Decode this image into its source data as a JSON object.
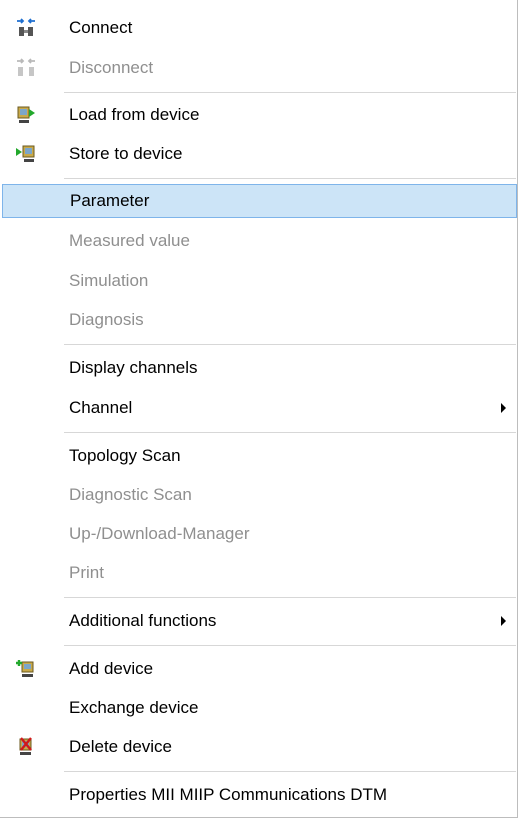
{
  "menu": {
    "connect": "Connect",
    "disconnect": "Disconnect",
    "load_from_device": "Load from device",
    "store_to_device": "Store to device",
    "parameter": "Parameter",
    "measured_value": "Measured value",
    "simulation": "Simulation",
    "diagnosis": "Diagnosis",
    "display_channels": "Display channels",
    "channel": "Channel",
    "topology_scan": "Topology Scan",
    "diagnostic_scan": "Diagnostic Scan",
    "up_download_manager": "Up-/Download-Manager",
    "print": "Print",
    "additional_functions": "Additional functions",
    "add_device": "Add device",
    "exchange_device": "Exchange device",
    "delete_device": "Delete device",
    "properties": "Properties MII MIIP Communications DTM"
  },
  "icons": {
    "connect": "connect-icon",
    "disconnect": "disconnect-icon",
    "load_from_device": "load-from-device-icon",
    "store_to_device": "store-to-device-icon",
    "add_device": "add-device-icon",
    "delete_device": "delete-device-icon"
  },
  "colors": {
    "highlight_bg": "#cce4f7",
    "highlight_border": "#7eb4ea",
    "disabled_text": "#8f8f8f"
  }
}
